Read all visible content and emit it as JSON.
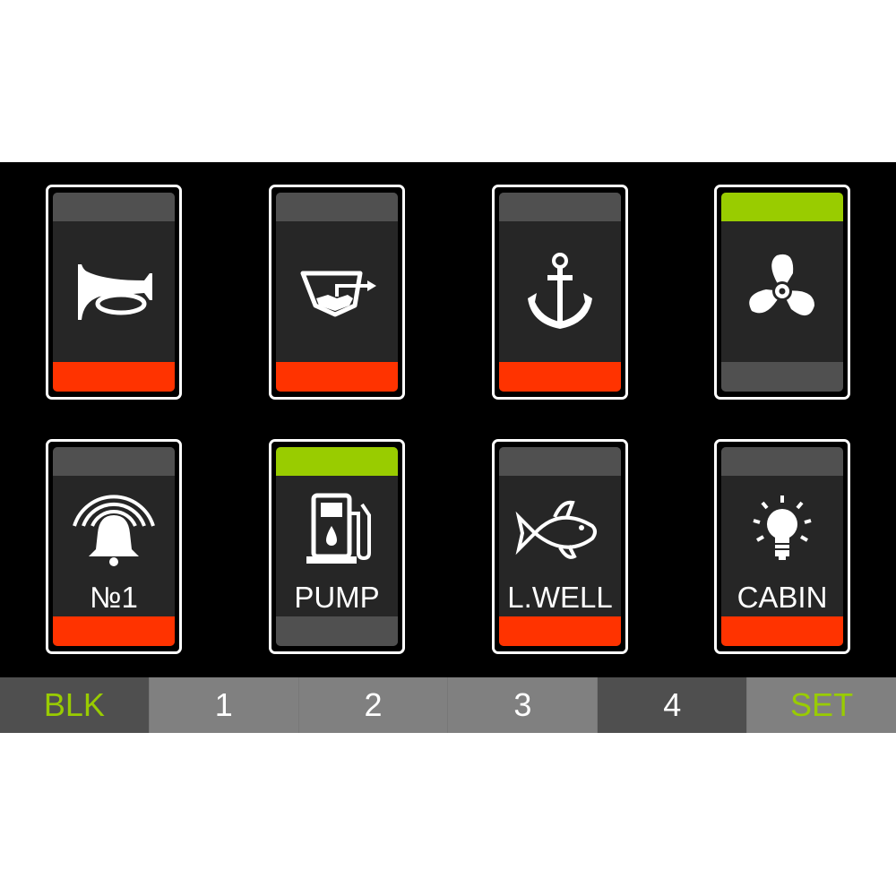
{
  "colors": {
    "on": "#99cc00",
    "off": "#ff3300",
    "idle": "#505050",
    "panel": "#262626",
    "tab_dark": "#4f4f4f",
    "tab_light": "#808080",
    "accent_text": "#99cc00"
  },
  "switches": [
    {
      "icon": "horn-icon",
      "label": "",
      "state": "off"
    },
    {
      "icon": "bilge-pump-icon",
      "label": "",
      "state": "off"
    },
    {
      "icon": "anchor-icon",
      "label": "",
      "state": "off"
    },
    {
      "icon": "fan-icon",
      "label": "",
      "state": "on"
    },
    {
      "icon": "alarm-bell-icon",
      "label": "№1",
      "state": "off"
    },
    {
      "icon": "fuel-pump-icon",
      "label": "PUMP",
      "state": "on"
    },
    {
      "icon": "fish-icon",
      "label": "L.WELL",
      "state": "off"
    },
    {
      "icon": "light-bulb-icon",
      "label": "CABIN",
      "state": "off"
    }
  ],
  "tabs": [
    {
      "label": "BLK",
      "active": true,
      "accent": true
    },
    {
      "label": "1",
      "active": false,
      "accent": false
    },
    {
      "label": "2",
      "active": false,
      "accent": false
    },
    {
      "label": "3",
      "active": false,
      "accent": false
    },
    {
      "label": "4",
      "active": true,
      "accent": false
    },
    {
      "label": "SET",
      "active": false,
      "accent": true
    }
  ]
}
